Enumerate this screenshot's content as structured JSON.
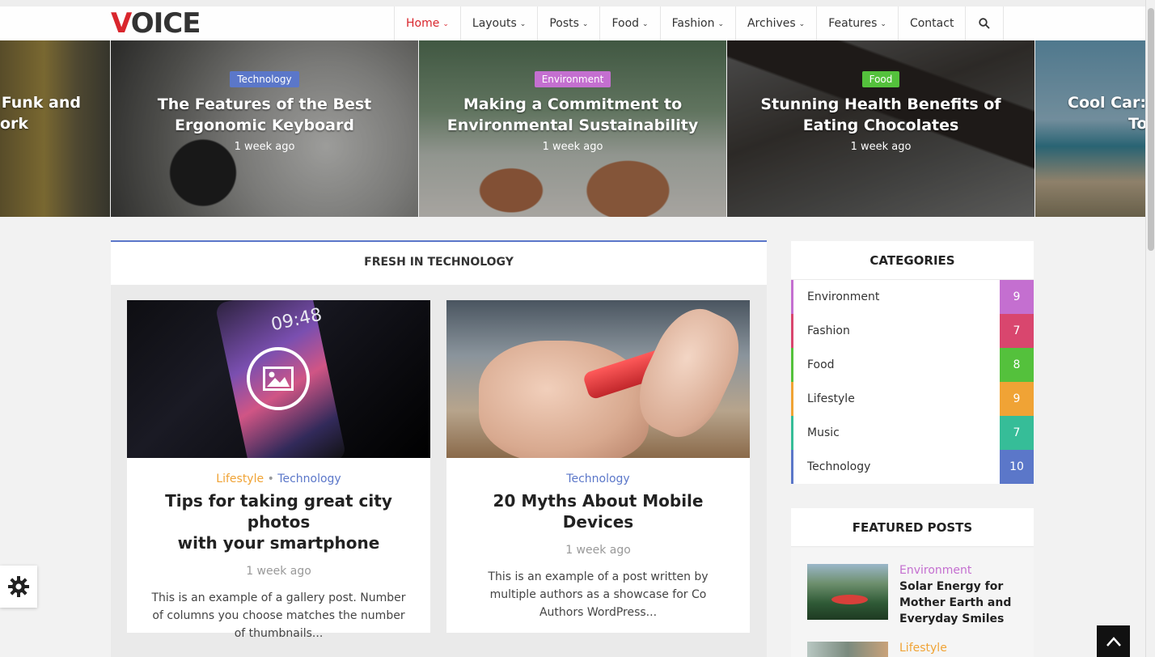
{
  "header": {
    "logo_first": "V",
    "logo_rest": "OICE",
    "nav": [
      {
        "label": "Home",
        "active": true,
        "dropdown": true
      },
      {
        "label": "Layouts",
        "dropdown": true
      },
      {
        "label": "Posts",
        "dropdown": true
      },
      {
        "label": "Food",
        "dropdown": true
      },
      {
        "label": "Fashion",
        "dropdown": true
      },
      {
        "label": "Archives",
        "dropdown": true
      },
      {
        "label": "Features",
        "dropdown": true
      },
      {
        "label": "Contact",
        "dropdown": false
      }
    ],
    "search_icon": "search-icon"
  },
  "slider": {
    "slides": [
      {
        "title": "Funk and ork",
        "line1": "Funk and",
        "line2": "ork"
      },
      {
        "tag": "Technology",
        "tag_color": "#5b77c9",
        "line1": "The Features of the Best",
        "line2": "Ergonomic Keyboard",
        "time": "1 week ago"
      },
      {
        "tag": "Environment",
        "tag_color": "#c46fd0",
        "line1": "Making a Commitment to",
        "line2": "Environmental Sustainability",
        "time": "1 week ago"
      },
      {
        "tag": "Food",
        "tag_color": "#54c13c",
        "line1": "Stunning Health Benefits of",
        "line2": "Eating Chocolates",
        "time": "1 week ago"
      },
      {
        "line1": "Cool Car:",
        "line2": "To"
      }
    ]
  },
  "main": {
    "section_title": "FRESH IN TECHNOLOGY",
    "cards": [
      {
        "cat1": "Lifestyle",
        "cat1_color": "#f0a335",
        "sep": "•",
        "cat2": "Technology",
        "cat2_color": "#5b77c9",
        "line1": "Tips for taking great city photos",
        "line2": "with your smartphone",
        "time": "1 week ago",
        "excerpt": "This is an example of a gallery post. Number of columns you choose matches the number of thumbnails..."
      },
      {
        "cat1": "Technology",
        "cat1_color": "#5b77c9",
        "line1": "20 Myths About Mobile Devices",
        "time": "1 week ago",
        "excerpt": "This is an example of a post written by multiple authors as a showcase for Co Authors WordPress..."
      }
    ]
  },
  "sidebar": {
    "categories_title": "CATEGORIES",
    "categories": [
      {
        "name": "Environment",
        "count": "9",
        "color": "#c46fd0"
      },
      {
        "name": "Fashion",
        "count": "7",
        "color": "#d9466e"
      },
      {
        "name": "Food",
        "count": "8",
        "color": "#54c13c"
      },
      {
        "name": "Lifestyle",
        "count": "9",
        "color": "#f0a335"
      },
      {
        "name": "Music",
        "count": "7",
        "color": "#36bd98"
      },
      {
        "name": "Technology",
        "count": "10",
        "color": "#5b77c9"
      }
    ],
    "featured_title": "FEATURED POSTS",
    "featured": [
      {
        "cat": "Environment",
        "cat_color": "#c46fd0",
        "title": "Solar Energy for Mother Earth and Everyday Smiles"
      },
      {
        "cat": "Lifestyle",
        "cat_color": "#f0a335"
      }
    ]
  }
}
